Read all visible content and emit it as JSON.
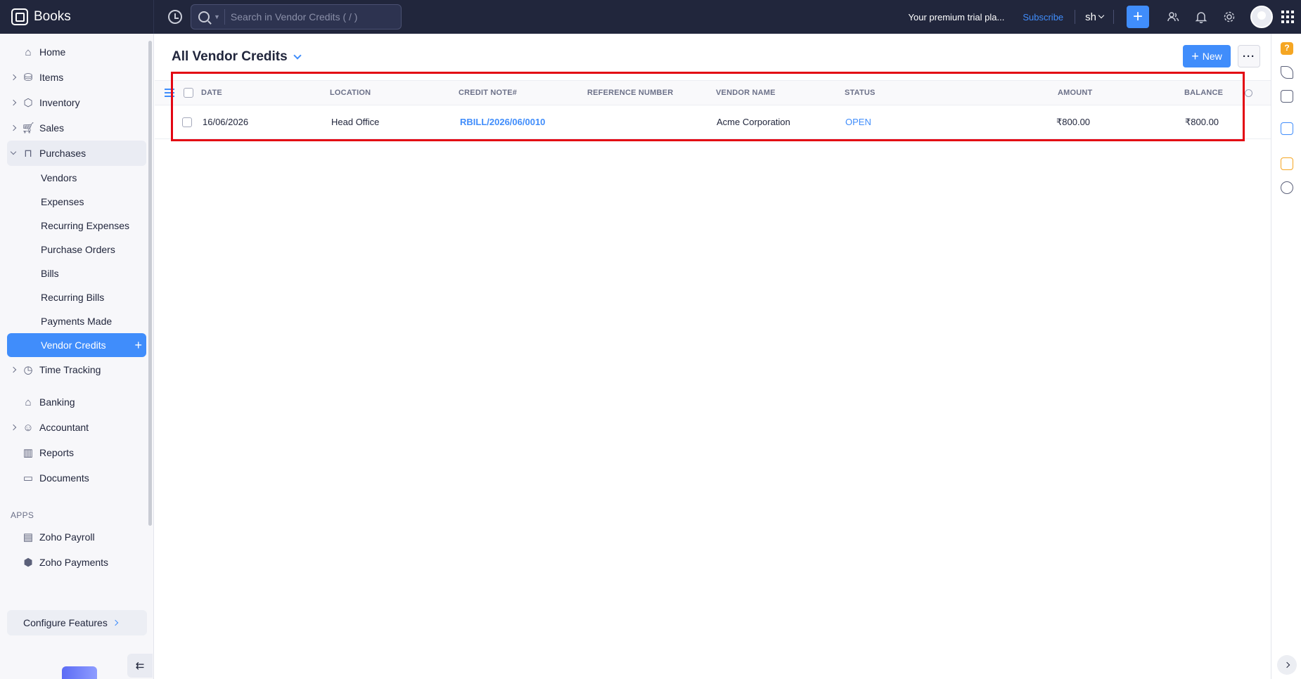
{
  "app": {
    "name": "Books"
  },
  "topbar": {
    "search_placeholder": "Search in Vendor Credits ( / )",
    "trial_text": "Your premium trial pla...",
    "subscribe_label": "Subscribe",
    "org_label": "sh",
    "quick_create_symbol": "+"
  },
  "sidebar": {
    "items": [
      {
        "label": "Home",
        "icon": "home-icon"
      },
      {
        "label": "Items",
        "icon": "items-icon",
        "expandable": true
      },
      {
        "label": "Inventory",
        "icon": "inventory-icon",
        "expandable": true
      },
      {
        "label": "Sales",
        "icon": "cart-icon",
        "expandable": true
      },
      {
        "label": "Purchases",
        "icon": "bag-icon",
        "expandable": true,
        "expanded": true
      }
    ],
    "purchases_sub": [
      {
        "label": "Vendors"
      },
      {
        "label": "Expenses"
      },
      {
        "label": "Recurring Expenses"
      },
      {
        "label": "Purchase Orders"
      },
      {
        "label": "Bills"
      },
      {
        "label": "Recurring Bills"
      },
      {
        "label": "Payments Made"
      },
      {
        "label": "Vendor Credits",
        "selected": true
      }
    ],
    "items_after": [
      {
        "label": "Time Tracking",
        "icon": "timer-icon",
        "expandable": true
      },
      {
        "label": "Banking",
        "icon": "bank-icon"
      },
      {
        "label": "Accountant",
        "icon": "accountant-icon",
        "expandable": true
      },
      {
        "label": "Reports",
        "icon": "reports-icon"
      },
      {
        "label": "Documents",
        "icon": "folder-icon"
      }
    ],
    "apps_title": "APPS",
    "apps": [
      {
        "label": "Zoho Payroll",
        "icon": "payroll-icon"
      },
      {
        "label": "Zoho Payments",
        "icon": "payments-icon"
      }
    ],
    "configure_label": "Configure Features"
  },
  "main": {
    "title": "All Vendor Credits",
    "new_button": "New",
    "more_button": "···",
    "table": {
      "columns": [
        "DATE",
        "LOCATION",
        "CREDIT NOTE#",
        "REFERENCE NUMBER",
        "VENDOR NAME",
        "STATUS",
        "AMOUNT",
        "BALANCE"
      ],
      "rows": [
        {
          "date": "16/06/2026",
          "location": "Head Office",
          "credit_note": "RBILL/2026/06/0010",
          "reference": "",
          "vendor": "Acme Corporation",
          "status": "OPEN",
          "amount": "₹800.00",
          "balance": "₹800.00"
        }
      ]
    }
  },
  "colors": {
    "accent": "#408dfb",
    "topbar": "#21263c",
    "highlight": "#e30613",
    "help": "#f5a623"
  }
}
